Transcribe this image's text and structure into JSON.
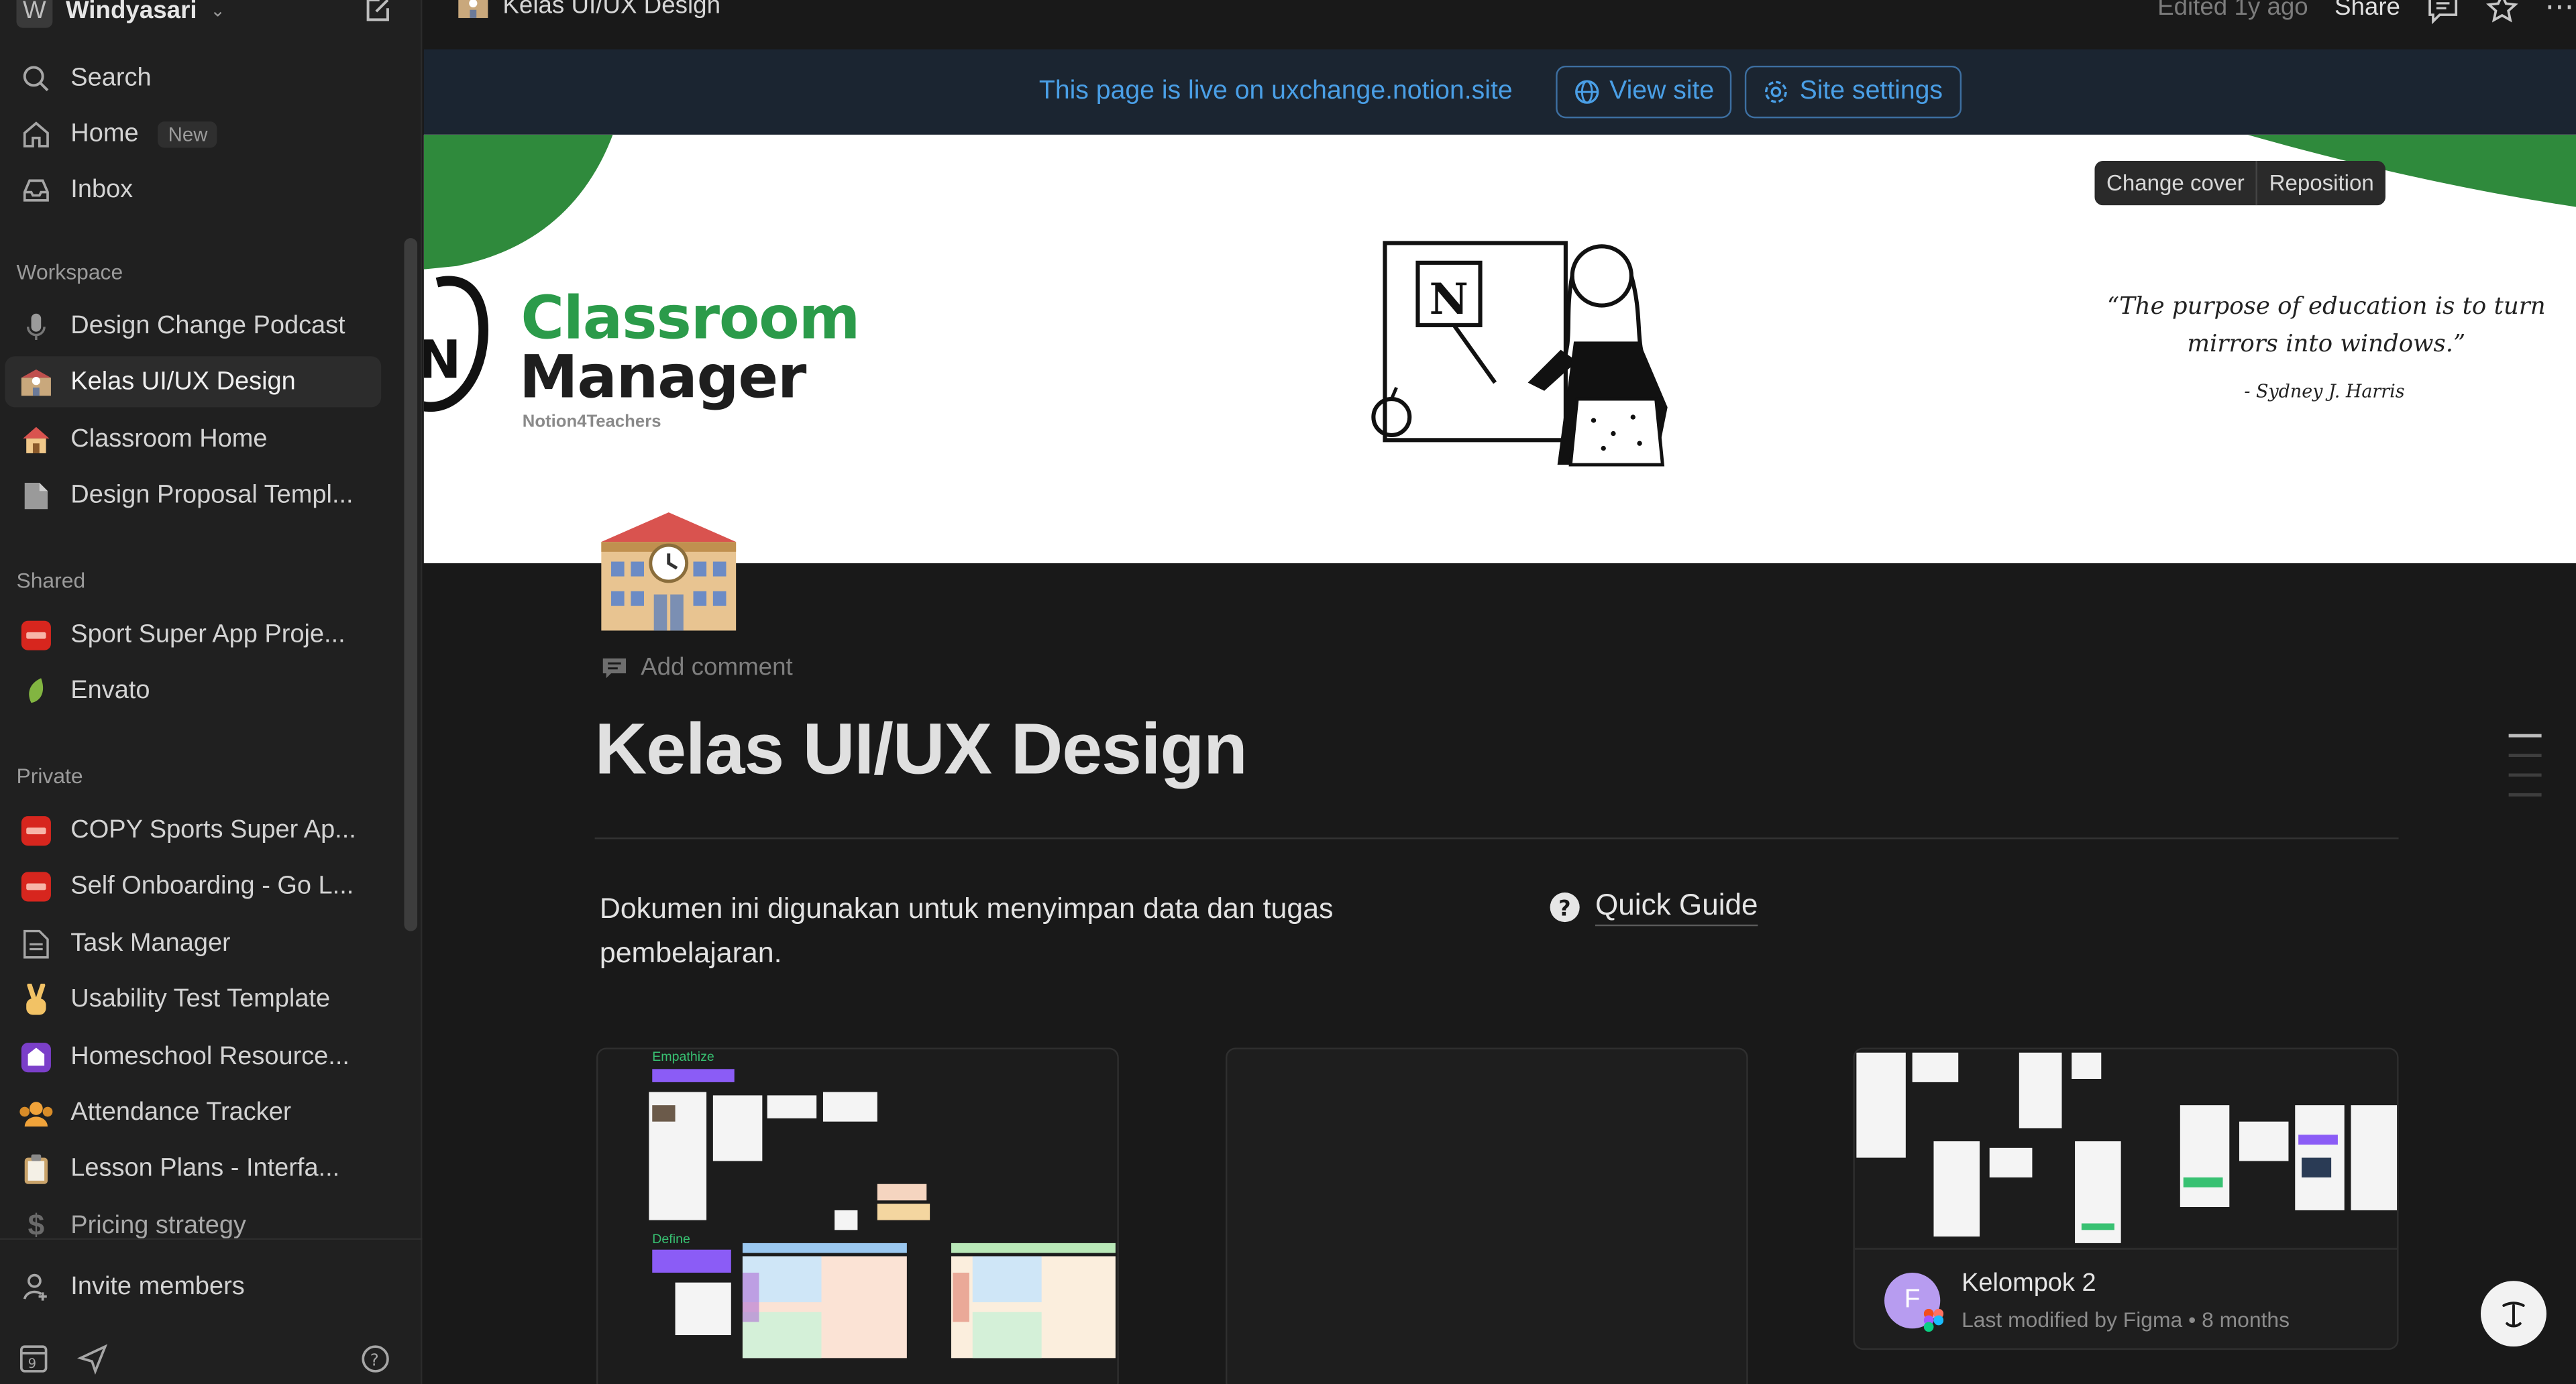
{
  "workspace": {
    "avatar_letter": "W",
    "name": "Windyasari"
  },
  "sidebar": {
    "top_items": [
      {
        "label": "Search",
        "icon": "search-icon"
      },
      {
        "label": "Home",
        "icon": "home-icon",
        "badge": "New"
      },
      {
        "label": "Inbox",
        "icon": "inbox-icon"
      }
    ],
    "sections": {
      "workspace": "Workspace",
      "shared": "Shared",
      "private": "Private"
    },
    "workspace_items": [
      {
        "label": "Design Change Podcast",
        "icon": "microphone-icon"
      },
      {
        "label": "Kelas UI/UX Design",
        "icon": "school-icon",
        "active": true
      },
      {
        "label": "Classroom Home",
        "icon": "house-icon"
      },
      {
        "label": "Design Proposal Templ...",
        "icon": "page-icon"
      }
    ],
    "shared_items": [
      {
        "label": "Sport Super App Proje...",
        "icon": "app-icon"
      },
      {
        "label": "Envato",
        "icon": "leaf-icon"
      }
    ],
    "private_items": [
      {
        "label": "COPY Sports Super Ap...",
        "icon": "app-icon"
      },
      {
        "label": "Self Onboarding - Go L...",
        "icon": "app-icon"
      },
      {
        "label": "Task Manager",
        "icon": "document-icon"
      },
      {
        "label": "Usability Test Template",
        "icon": "victory-hand-icon"
      },
      {
        "label": "Homeschool Resource...",
        "icon": "purple-app-icon"
      },
      {
        "label": "Attendance Tracker",
        "icon": "people-icon"
      },
      {
        "label": "Lesson Plans - Interfa...",
        "icon": "clipboard-icon"
      },
      {
        "label": "Pricing strategy",
        "icon": "dollar-icon"
      }
    ],
    "invite": "Invite members"
  },
  "topbar": {
    "breadcrumb": "Kelas UI/UX Design",
    "edited": "Edited 1y ago",
    "share": "Share"
  },
  "banner": {
    "text": "This page is live on uxchange.notion.site",
    "view_site": "View site",
    "site_settings": "Site settings"
  },
  "cover": {
    "change_cover": "Change cover",
    "reposition": "Reposition",
    "title_line1": "Classroom",
    "title_line2": "Manager",
    "subtitle": "Notion4Teachers",
    "quote": "“The purpose of education is to turn mirrors into windows.”",
    "author": "- Sydney J. Harris"
  },
  "page": {
    "add_comment": "Add comment",
    "title": "Kelas UI/UX Design",
    "description": "Dokumen ini digunakan untuk menyimpan data dan tugas pembelajaran.",
    "quick_guide": "Quick Guide"
  },
  "cards": [
    {
      "thumb_labels": [
        "Empathize",
        "Define"
      ]
    },
    {},
    {
      "avatar_letter": "F",
      "title": "Kelompok 2",
      "subtitle": "Last modified by Figma • 8 months"
    }
  ],
  "colors": {
    "accent_blue": "#4a9fe6",
    "brand_green": "#2b9b4a",
    "sidebar_bg": "#202020",
    "page_bg": "#191919"
  }
}
